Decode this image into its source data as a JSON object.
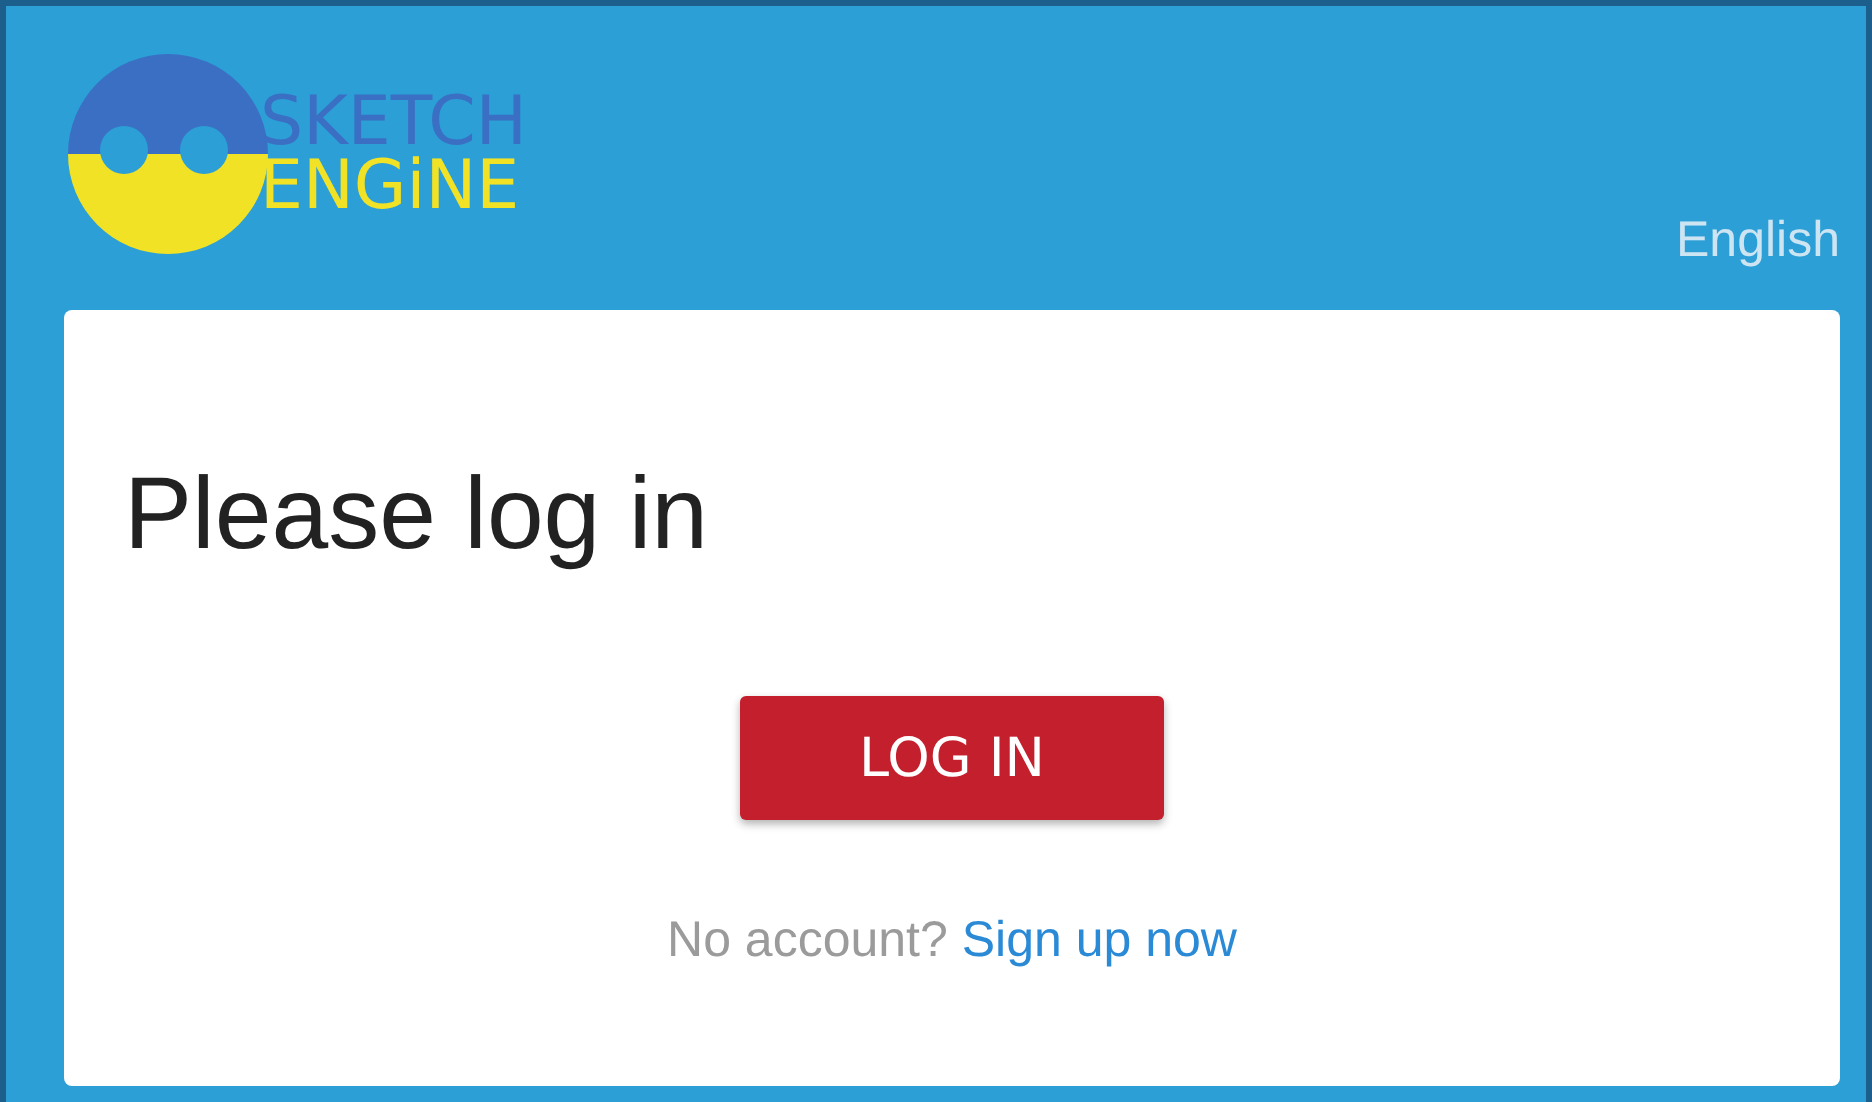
{
  "logo": {
    "line_1": "SKETCH",
    "line_2": "ENGiNE"
  },
  "language": "English",
  "card": {
    "title": "Please log in",
    "button": "LOG IN",
    "prompt": "No account?",
    "link": "Sign up now"
  }
}
